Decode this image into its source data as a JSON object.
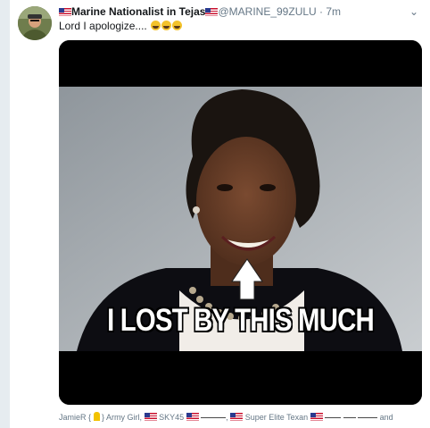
{
  "tweet": {
    "display_name": "Marine Nationalist in Tejas",
    "handle": "@MARINE_99ZULU",
    "separator": " · ",
    "time": "7m",
    "text": "Lord I apologize....",
    "emoji_icon": "rolling-on-floor-laughing-emoji"
  },
  "media": {
    "caption": "I LOST BY THIS MUCH",
    "icon": "arrow-up-icon"
  },
  "footer": {
    "part1": "JamieR {",
    "part2": "} Army Girl,",
    "part3": "SKY45",
    "part4": ",",
    "part5": "Super Elite Texan",
    "part6": "and"
  },
  "colors": {
    "flag_red": "#c8102e",
    "flag_blue": "#2a3a8f",
    "handle_gray": "#657786",
    "emoji_yellow": "#f3c22b"
  }
}
